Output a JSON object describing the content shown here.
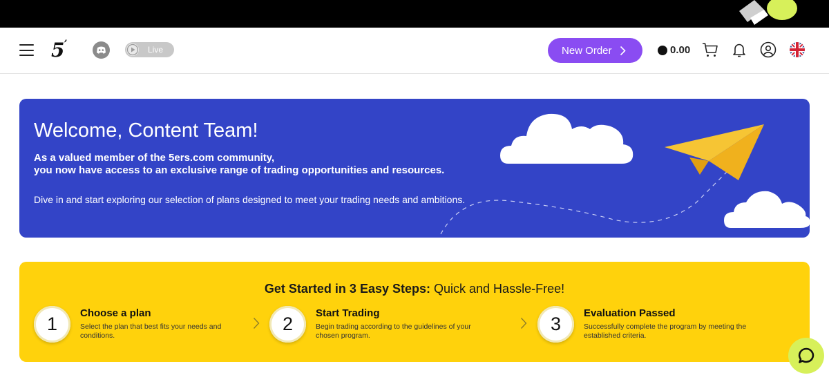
{
  "header": {
    "logo_text": "5",
    "logo_mark": "ers",
    "live_label": "Live",
    "new_order_label": "New Order",
    "balance": "0.00",
    "icons": [
      "menu-icon",
      "discord-icon",
      "play-icon",
      "chevron-right-icon",
      "coin-icon",
      "cart-icon",
      "bell-icon",
      "user-icon",
      "uk-flag-icon"
    ]
  },
  "welcome": {
    "title": "Welcome, Content Team!",
    "lead_line1": "As a valued member of the 5ers.com community,",
    "lead_line2": "you now have access to an exclusive range of trading opportunities and resources.",
    "body": "Dive in and start exploring our selection of plans designed to meet your trading needs and ambitions.",
    "background_color": "#3344c7"
  },
  "steps": {
    "heading_bold": "Get Started in 3 Easy Steps:",
    "heading_rest": "Quick and Hassle-Free!",
    "background_color": "#ffd20c",
    "items": [
      {
        "number": "1",
        "title": "Choose a plan",
        "desc": "Select the plan that best fits your needs and conditions."
      },
      {
        "number": "2",
        "title": "Start Trading",
        "desc": "Begin trading according to the guidelines of your chosen program."
      },
      {
        "number": "3",
        "title": "Evaluation Passed",
        "desc": "Successfully complete the program by meeting the established criteria."
      }
    ]
  },
  "colors": {
    "accent_purple": "#8a4cf2",
    "chat_green": "#d7f05a"
  }
}
